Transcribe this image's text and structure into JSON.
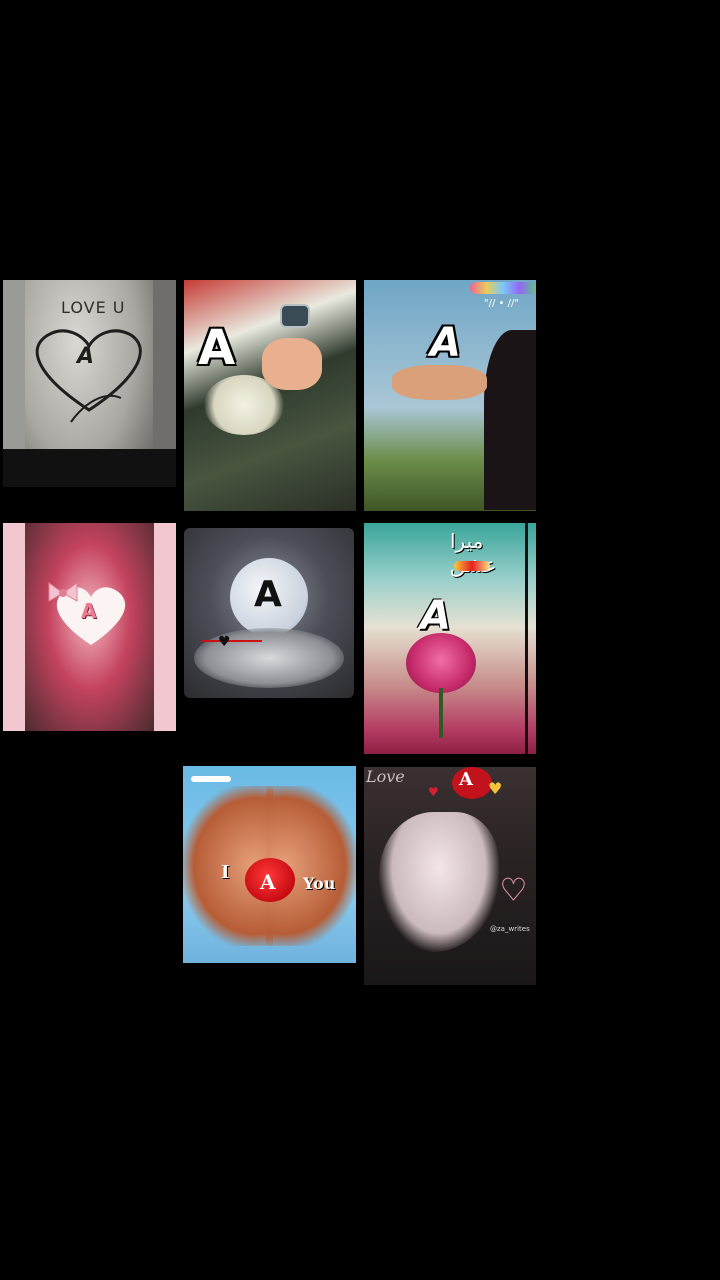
{
  "grid": {
    "tiles": [
      {
        "name": "tile-love-u-sand-heart",
        "text": "LOVE U",
        "letter": "A"
      },
      {
        "name": "tile-holding-hands",
        "letter": "A"
      },
      {
        "name": "tile-sky-girl",
        "letter": "A",
        "badge": "\"// • //\""
      },
      {
        "name": "tile-pink-bow-heart",
        "letter": "A"
      },
      {
        "name": "tile-moon",
        "letter": "A"
      },
      {
        "name": "tile-rose",
        "letter": "A",
        "urdu": "میرا عشق"
      },
      {
        "name": "tile-heart-hands",
        "left_word": "I",
        "letter": "A",
        "right_word": "You"
      },
      {
        "name": "tile-dark-hand",
        "script": "Love",
        "letter": "A",
        "watermark": "@za_writes"
      }
    ]
  },
  "colors": {
    "background": "#000000"
  }
}
